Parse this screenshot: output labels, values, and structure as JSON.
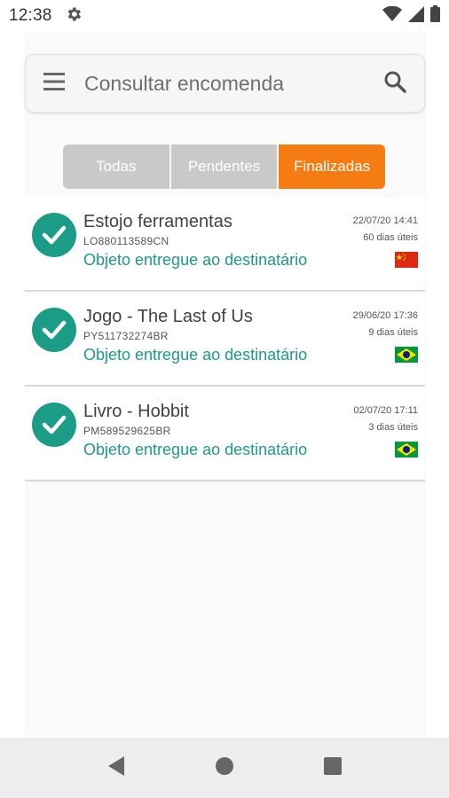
{
  "status_bar": {
    "time": "12:38",
    "icons": [
      "settings-icon",
      "wifi-icon",
      "signal-icon",
      "battery-icon"
    ]
  },
  "search": {
    "placeholder": "Consultar encomenda",
    "menu_icon": "menu-icon",
    "search_icon": "search-icon"
  },
  "tabs": [
    {
      "label": "Todas",
      "active": false
    },
    {
      "label": "Pendentes",
      "active": false
    },
    {
      "label": "Finalizadas",
      "active": true
    }
  ],
  "colors": {
    "accent": "#f57c12",
    "success": "#1a9c86",
    "tab_inactive": "#c9c9c9"
  },
  "items": [
    {
      "title": "Estojo ferramentas",
      "code": "LO880113589CN",
      "status": "Objeto entregue ao destinatário",
      "date": "22/07/20 14:41",
      "days": "60 dias úteis",
      "flag": "china-flag-icon"
    },
    {
      "title": "Jogo - The Last of Us",
      "code": "PY511732274BR",
      "status": "Objeto entregue ao destinatário",
      "date": "29/06/20 17:36",
      "days": "9 dias úteis",
      "flag": "brazil-flag-icon"
    },
    {
      "title": "Livro - Hobbit",
      "code": "PM589529625BR",
      "status": "Objeto entregue ao destinatário",
      "date": "02/07/20 17:11",
      "days": "3 dias úteis",
      "flag": "brazil-flag-icon"
    }
  ],
  "nav": {
    "back_icon": "back-icon",
    "home_icon": "home-icon",
    "recents_icon": "recents-icon"
  }
}
